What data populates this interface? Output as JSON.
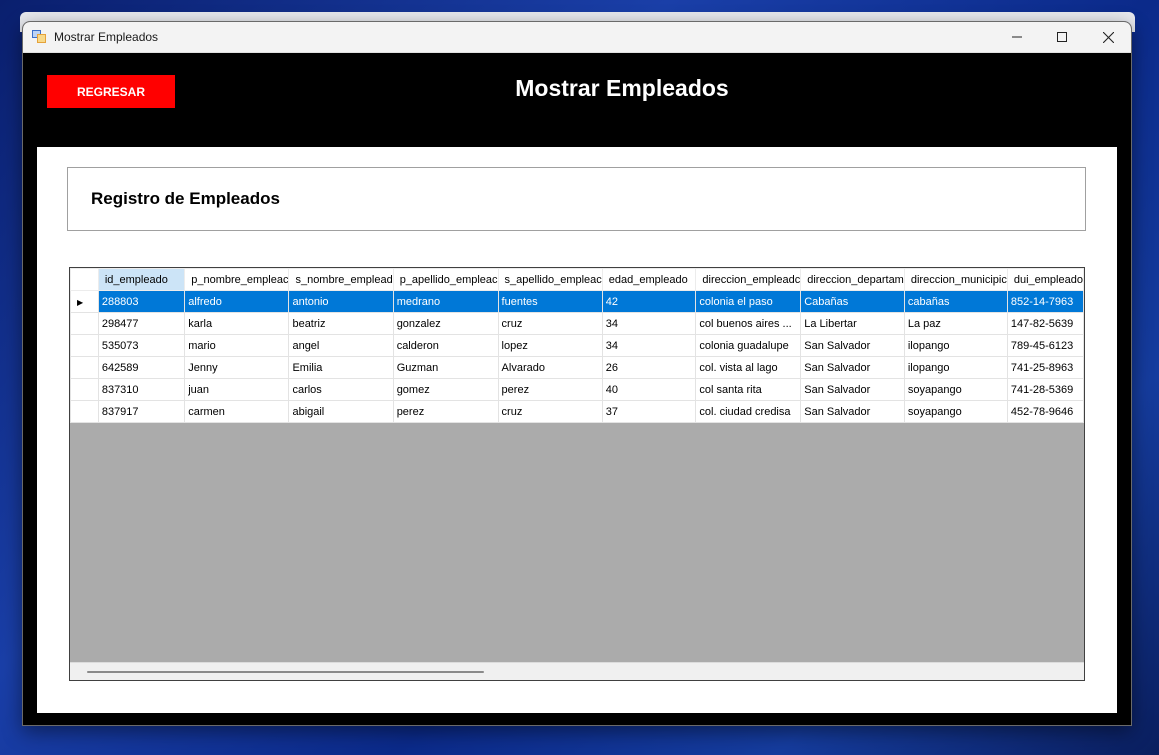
{
  "window": {
    "title": "Mostrar Empleados",
    "controls": {
      "minimize": "—",
      "maximize": "☐",
      "close": "✕"
    }
  },
  "header": {
    "back_label": "REGRESAR",
    "title": "Mostrar Empleados"
  },
  "section": {
    "title": "Registro de Empleados"
  },
  "grid": {
    "columns": [
      "id_empleado",
      "p_nombre_empleado",
      "s_nombre_empleado",
      "p_apellido_empleado",
      "s_apellido_empleado",
      "edad_empleado",
      "direccion_empleado",
      "direccion_departamento",
      "direccion_municipio",
      "dui_empleado"
    ],
    "columns_visible": [
      "id_empleado",
      "p_nombre_empleac",
      "s_nombre_emplead",
      "p_apellido_empleac",
      "s_apellido_empleac",
      "edad_empleado",
      "direccion_empleadc",
      "direccion_departam",
      "direccion_municipic",
      "dui_empleado"
    ],
    "rows": [
      [
        "288803",
        "alfredo",
        "antonio",
        "medrano",
        "fuentes",
        "42",
        "colonia el paso",
        "Cabañas",
        "cabañas",
        "852-14-7963"
      ],
      [
        "298477",
        "karla",
        "beatriz",
        "gonzalez",
        "cruz",
        "34",
        "col buenos aires ...",
        "La Libertar",
        "La paz",
        "147-82-5639"
      ],
      [
        "535073",
        "mario",
        "angel",
        "calderon",
        "lopez",
        "34",
        "colonia guadalupe",
        "San Salvador",
        "ilopango",
        "789-45-6123"
      ],
      [
        "642589",
        "Jenny",
        "Emilia",
        "Guzman",
        "Alvarado",
        "26",
        "col. vista al lago",
        "San Salvador",
        "ilopango",
        "741-25-8963"
      ],
      [
        "837310",
        "juan",
        "carlos",
        "gomez",
        "perez",
        "40",
        "col santa rita",
        "San Salvador",
        "soyapango",
        "741-28-5369"
      ],
      [
        "837917",
        "carmen",
        "abigail",
        "perez",
        "cruz",
        "37",
        "col. ciudad credisa",
        "San Salvador",
        "soyapango",
        "452-78-9646"
      ]
    ],
    "selected_row": 0,
    "current_row_marker": "▶"
  },
  "colors": {
    "header_bg": "#000000",
    "back_button": "#ff0000",
    "selection": "#0078d7",
    "grid_empty": "#ababab"
  }
}
